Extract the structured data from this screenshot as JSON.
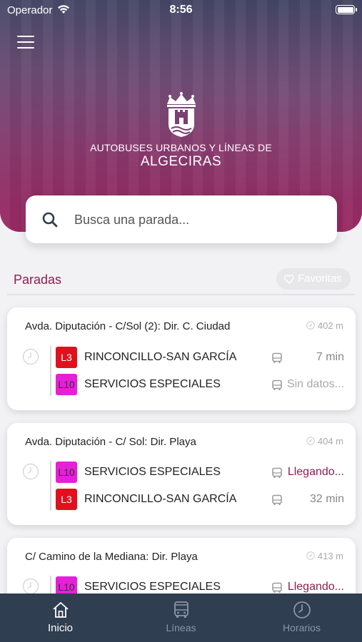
{
  "status_bar": {
    "carrier": "Operador",
    "time": "8:56"
  },
  "header": {
    "subtitle": "AUTOBUSES URBANOS Y LÍNEAS DE",
    "title": "ALGECIRAS"
  },
  "search": {
    "placeholder": "Busca una parada..."
  },
  "section": {
    "title": "Paradas",
    "favorites_label": "Favoritas"
  },
  "stops": [
    {
      "name": "Avda. Diputación - C/Sol (2): Dir. C. Ciudad",
      "distance": "402 m",
      "lines": [
        {
          "code": "L3",
          "name": "RINCONCILLO-SAN GARCÍA",
          "eta": "7 min",
          "color": "#e0111c"
        },
        {
          "code": "L10",
          "name": "SERVICIOS ESPECIALES",
          "eta": "Sin datos...",
          "color": "#e61fd8"
        }
      ]
    },
    {
      "name": "Avda. Diputación - C/ Sol: Dir. Playa",
      "distance": "404 m",
      "lines": [
        {
          "code": "L10",
          "name": "SERVICIOS ESPECIALES",
          "eta": "Llegando...",
          "color": "#e61fd8"
        },
        {
          "code": "L3",
          "name": "RINCONCILLO-SAN GARCÍA",
          "eta": "32 min",
          "color": "#e0111c"
        }
      ]
    },
    {
      "name": "C/ Camino de la Mediana: Dir. Playa",
      "distance": "413 m",
      "lines": [
        {
          "code": "L10",
          "name": "SERVICIOS ESPECIALES",
          "eta": "Llegando...",
          "color": "#e61fd8"
        }
      ]
    }
  ],
  "tabs": [
    {
      "label": "Inicio",
      "icon": "home-icon",
      "active": true
    },
    {
      "label": "Líneas",
      "icon": "bus-icon",
      "active": false
    },
    {
      "label": "Horarios",
      "icon": "clock-icon",
      "active": false
    }
  ],
  "colors": {
    "brand": "#8a1f4f",
    "tabbar": "#2f3e50",
    "line_l3": "#e0111c",
    "line_l10": "#e61fd8"
  }
}
